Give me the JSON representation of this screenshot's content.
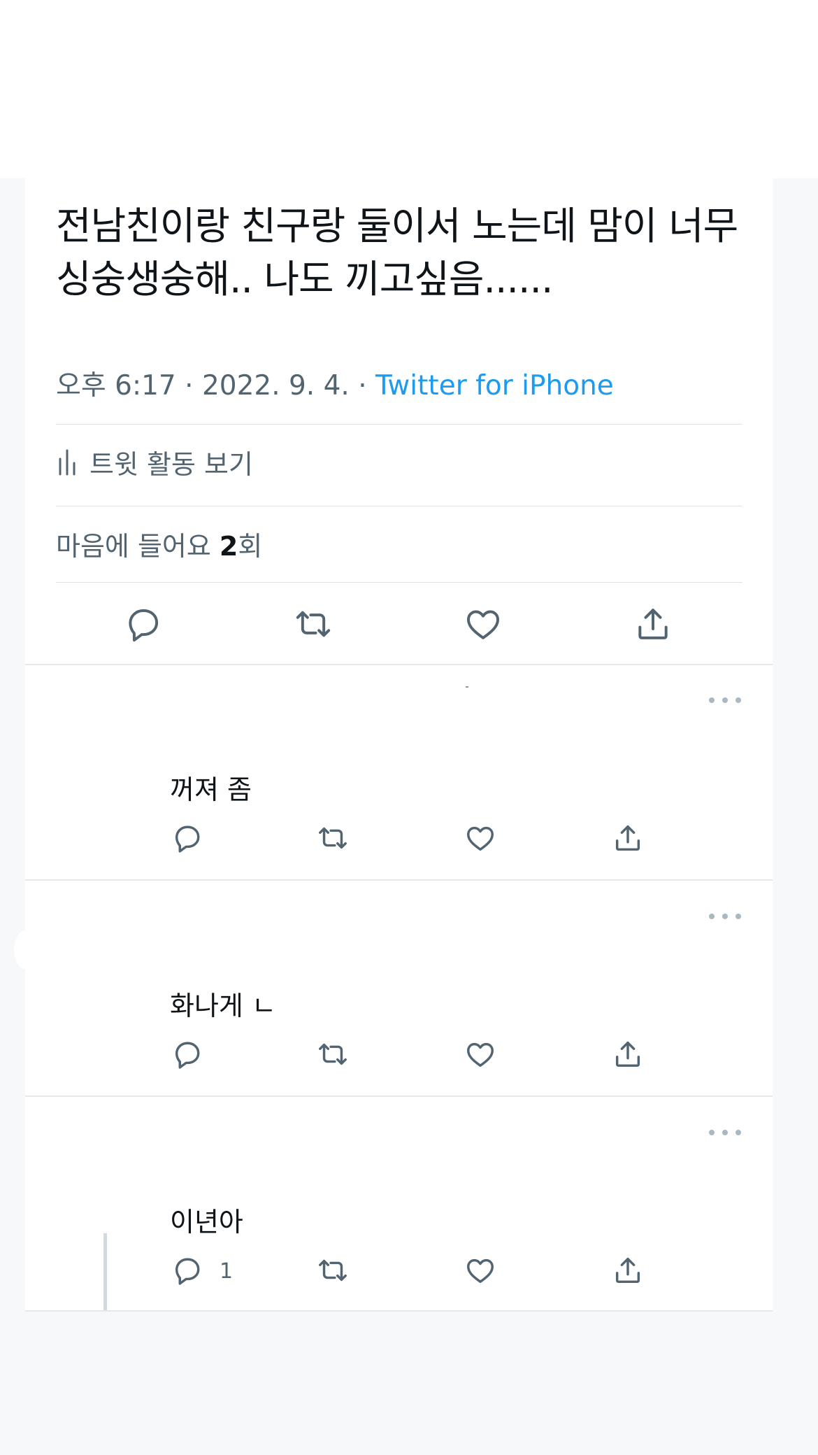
{
  "tweet": {
    "text": "전남친이랑 친구랑 둘이서 노는데 맘이 너무 싱숭생숭해.. 나도 끼고싶음......",
    "time": "오후 6:17",
    "date": "2022. 9. 4.",
    "separator": " · ",
    "source": "Twitter for iPhone",
    "activity_label": "트윗 활동 보기",
    "likes_prefix": "마음에 들어요 ",
    "likes_count": "2",
    "likes_suffix": "회"
  },
  "actions": {
    "icons": [
      "reply-icon",
      "retweet-icon",
      "like-icon",
      "share-icon"
    ]
  },
  "replies": [
    {
      "text": "꺼져 좀",
      "reply_count": ""
    },
    {
      "text": "화나게 ㄴ",
      "reply_count": ""
    },
    {
      "text": "이년아",
      "reply_count": "1"
    }
  ],
  "colors": {
    "accent": "#1d9bf0",
    "secondary_text": "#536471",
    "primary_text": "#0f1419",
    "divider": "#dfe3e6",
    "page_background": "#f7f8fa"
  }
}
